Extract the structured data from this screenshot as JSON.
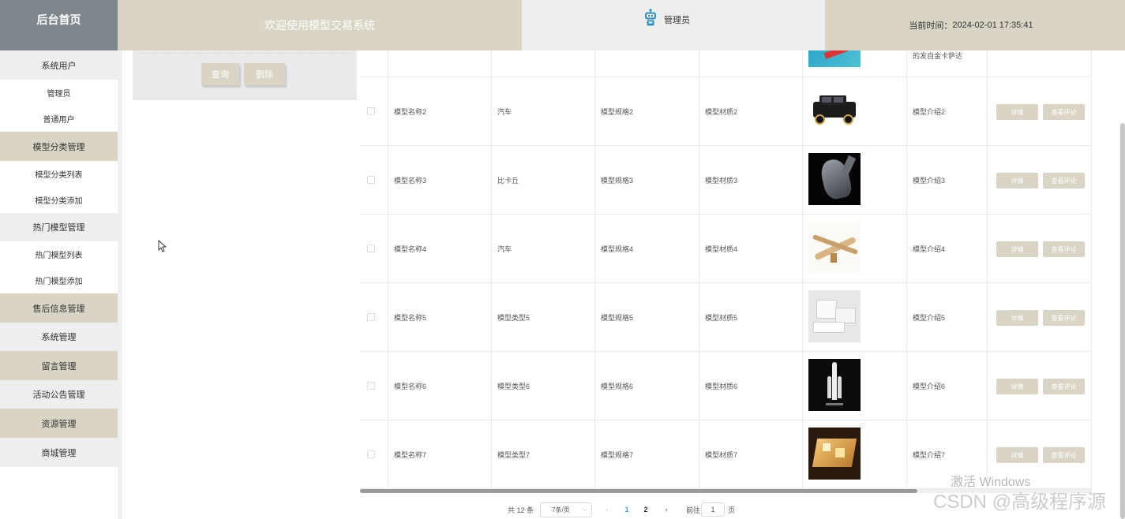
{
  "header": {
    "home": "后台首页",
    "title": "欢迎使用模型交易系统",
    "user": "管理员",
    "time_label": "当前时间：",
    "time_value": "2024-02-01 17:35:41"
  },
  "sidebar": {
    "items": [
      {
        "label": "系统用户",
        "style": "g"
      },
      {
        "label": "管理员",
        "style": "w"
      },
      {
        "label": "普通用户",
        "style": "w"
      },
      {
        "label": "模型分类管理",
        "style": "t"
      },
      {
        "label": "模型分类列表",
        "style": "w"
      },
      {
        "label": "模型分类添加",
        "style": "w"
      },
      {
        "label": "热门模型管理",
        "style": "g"
      },
      {
        "label": "热门模型列表",
        "style": "w"
      },
      {
        "label": "热门模型添加",
        "style": "w"
      },
      {
        "label": "售后信息管理",
        "style": "t"
      },
      {
        "label": "系统管理",
        "style": "g"
      },
      {
        "label": "留言管理",
        "style": "t"
      },
      {
        "label": "活动公告管理",
        "style": "g"
      },
      {
        "label": "资源管理",
        "style": "t"
      },
      {
        "label": "商城管理",
        "style": "g"
      }
    ]
  },
  "search": {
    "query_label": "查询",
    "delete_label": "删除"
  },
  "table": {
    "partial_row_intro": "的发自金卡萨达",
    "rows": [
      {
        "name": "模型名称2",
        "type": "汽车",
        "spec": "模型规格2",
        "material": "模型材质2",
        "image": "black-suv-model",
        "intro": "模型介绍2"
      },
      {
        "name": "模型名称3",
        "type": "比卡丘",
        "spec": "模型规格3",
        "material": "模型材质3",
        "image": "helmet-model",
        "intro": "模型介绍3"
      },
      {
        "name": "模型名称4",
        "type": "汽车",
        "spec": "模型规格4",
        "material": "模型材质4",
        "image": "wooden-airplane-model",
        "intro": "模型介绍4"
      },
      {
        "name": "模型名称5",
        "type": "模型类型5",
        "spec": "模型规格5",
        "material": "模型材质5",
        "image": "architecture-model",
        "intro": "模型介绍5"
      },
      {
        "name": "模型名称6",
        "type": "模型类型6",
        "spec": "模型规格6",
        "material": "模型材质6",
        "image": "rocket-model",
        "intro": "模型介绍6"
      },
      {
        "name": "模型名称7",
        "type": "模型类型7",
        "spec": "模型规格7",
        "material": "模型材质7",
        "image": "building-model",
        "intro": "模型介绍7"
      }
    ],
    "detail_label": "详情",
    "review_label": "查看评论"
  },
  "pagination": {
    "total": "共 12 条",
    "page_size": "7条/页",
    "pages": [
      "1",
      "2"
    ],
    "current": "1",
    "goto_label": "前往",
    "goto_value": "1",
    "page_suffix": "页"
  },
  "watermark": {
    "line1": "激活 Windows",
    "line2": "CSDN @高级程序源"
  },
  "colors": {
    "accent": "#d9d4c4",
    "home_bg": "#7e868e",
    "page_link": "#409eff"
  }
}
